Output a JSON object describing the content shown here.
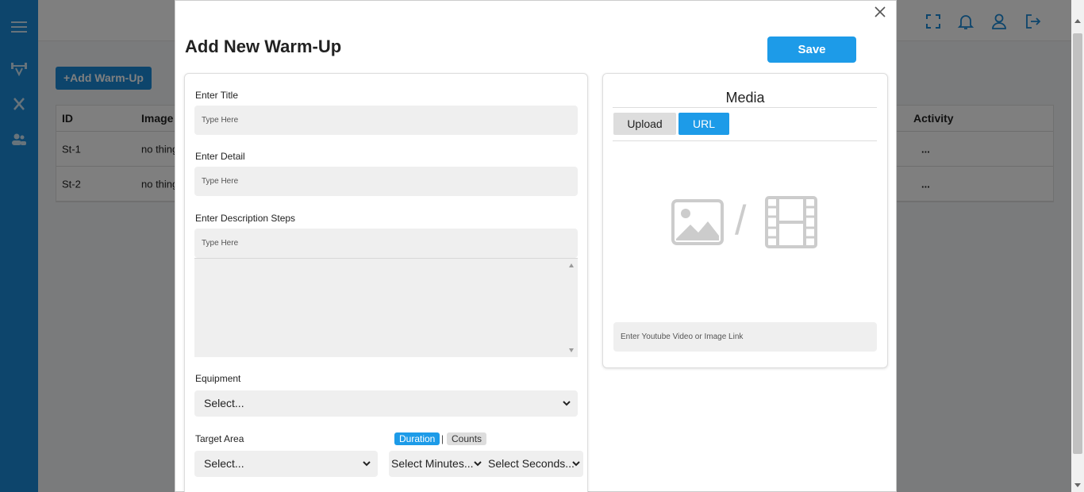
{
  "background": {
    "add_button_label": "+Add Warm-Up",
    "table": {
      "headers": {
        "id": "ID",
        "image": "Image",
        "activity": "Activity"
      },
      "rows": [
        {
          "id": "St-1",
          "image": "no thing",
          "activity": "..."
        },
        {
          "id": "St-2",
          "image": "no thing",
          "activity": "..."
        }
      ]
    }
  },
  "modal": {
    "title": "Add New Warm-Up",
    "save_label": "Save",
    "title_field": {
      "label": "Enter Title",
      "placeholder": "Type Here"
    },
    "detail_field": {
      "label": "Enter Detail",
      "placeholder": "Type Here"
    },
    "steps_field": {
      "label": "Enter Description Steps",
      "placeholder": "Type Here"
    },
    "equipment": {
      "label": "Equipment",
      "value": "Select..."
    },
    "target_area": {
      "label": "Target Area",
      "value": "Select..."
    },
    "mode_toggle": {
      "duration": "Duration",
      "separator": "|",
      "counts": "Counts",
      "selected": "Duration"
    },
    "minutes_select": "Select Minutes...",
    "seconds_select": "Select Seconds...",
    "media": {
      "title": "Media",
      "tab_upload": "Upload",
      "tab_url": "URL",
      "active_tab": "URL",
      "separator": "/",
      "link_placeholder": "Enter Youtube Video or Image Link"
    }
  },
  "colors": {
    "sidebar": "#1a8ad8",
    "accent": "#1d9be8",
    "field_bg": "#efefef"
  }
}
